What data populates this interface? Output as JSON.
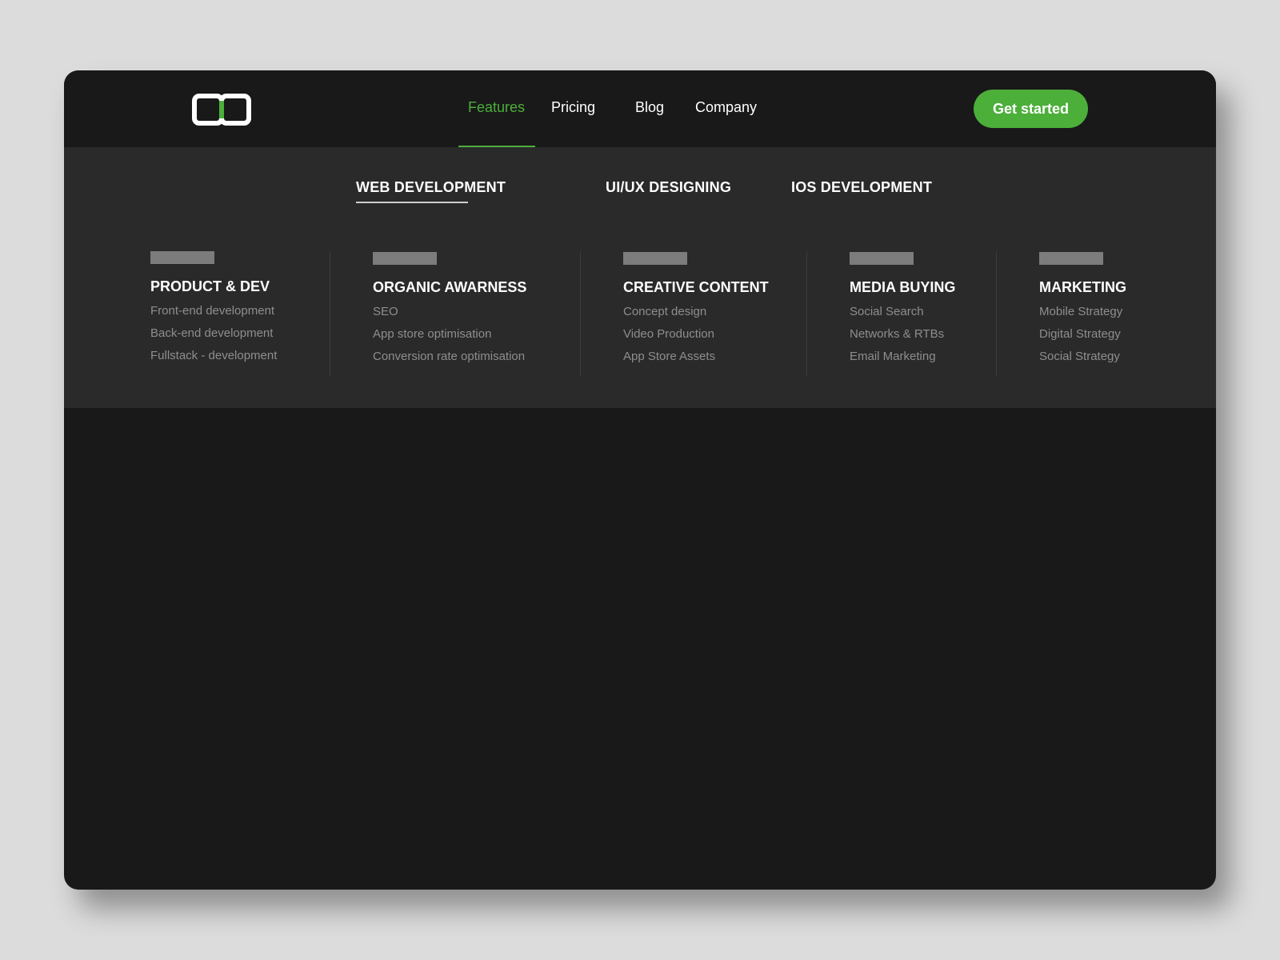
{
  "colors": {
    "accent": "#4caf3a",
    "page_background": "#dcdcdc",
    "window_background": "#191919",
    "menu_background": "#2a2a2a",
    "muted_text": "#8e8e8e",
    "placeholder": "#7c7c7c"
  },
  "header": {
    "logo_icon": "brand-logo-icon",
    "nav": [
      {
        "label": "Features",
        "active": true
      },
      {
        "label": "Pricing"
      },
      {
        "label": "Blog"
      },
      {
        "label": "Company"
      }
    ],
    "cta_label": "Get started"
  },
  "mega_menu": {
    "tabs": [
      {
        "label": "WEB DEVELOPMENT",
        "active": true
      },
      {
        "label": "UI/UX DESIGNING"
      },
      {
        "label": "IOS DEVELOPMENT"
      }
    ],
    "columns": [
      {
        "title": "PRODUCT & DEV",
        "items": [
          "Front-end development",
          "Back-end development",
          "Fullstack - development"
        ]
      },
      {
        "title": "ORGANIC AWARNESS",
        "items": [
          "SEO",
          "App store optimisation",
          "Conversion rate optimisation"
        ]
      },
      {
        "title": "CREATIVE CONTENT",
        "items": [
          "Concept design",
          "Video Production",
          "App Store Assets"
        ]
      },
      {
        "title": "MEDIA BUYING",
        "items": [
          "Social Search",
          "Networks & RTBs",
          "Email Marketing"
        ]
      },
      {
        "title": "MARKETING",
        "items": [
          "Mobile Strategy",
          "Digital Strategy",
          "Social Strategy"
        ]
      }
    ]
  }
}
